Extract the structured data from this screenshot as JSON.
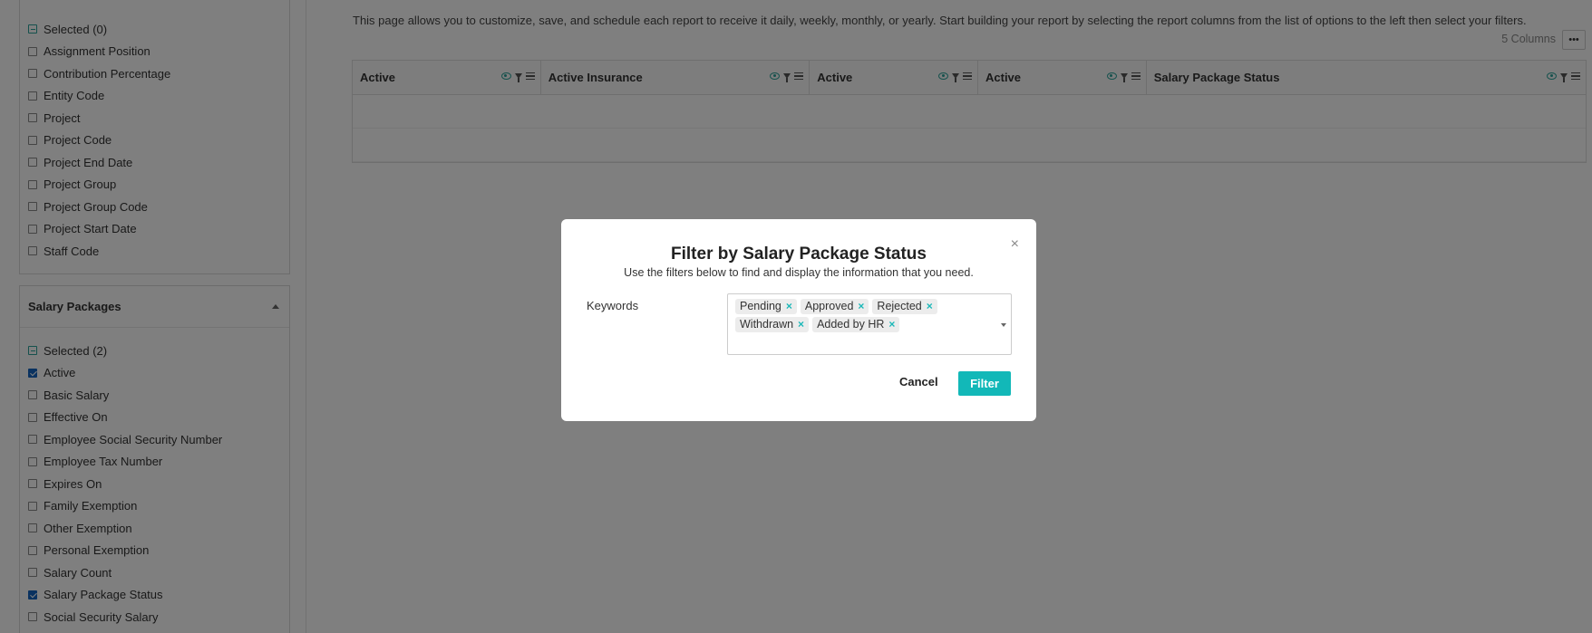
{
  "sidebar": {
    "top_panel": {
      "selected_label": "Selected (0)",
      "items": [
        {
          "label": "Assignment Position",
          "checked": false
        },
        {
          "label": "Contribution Percentage",
          "checked": false
        },
        {
          "label": "Entity Code",
          "checked": false
        },
        {
          "label": "Project",
          "checked": false
        },
        {
          "label": "Project Code",
          "checked": false
        },
        {
          "label": "Project End Date",
          "checked": false
        },
        {
          "label": "Project Group",
          "checked": false
        },
        {
          "label": "Project Group Code",
          "checked": false
        },
        {
          "label": "Project Start Date",
          "checked": false
        },
        {
          "label": "Staff Code",
          "checked": false
        }
      ]
    },
    "salary_panel": {
      "title": "Salary Packages",
      "selected_label": "Selected (2)",
      "items": [
        {
          "label": "Active",
          "checked": true
        },
        {
          "label": "Basic Salary",
          "checked": false
        },
        {
          "label": "Effective On",
          "checked": false
        },
        {
          "label": "Employee Social Security Number",
          "checked": false
        },
        {
          "label": "Employee Tax Number",
          "checked": false
        },
        {
          "label": "Expires On",
          "checked": false
        },
        {
          "label": "Family Exemption",
          "checked": false
        },
        {
          "label": "Other Exemption",
          "checked": false
        },
        {
          "label": "Personal Exemption",
          "checked": false
        },
        {
          "label": "Salary Count",
          "checked": false
        },
        {
          "label": "Salary Package Status",
          "checked": true
        },
        {
          "label": "Social Security Salary",
          "checked": false
        }
      ]
    }
  },
  "main": {
    "description": "This page allows you to customize, save, and schedule each report to receive it daily, weekly, monthly, or yearly. Start building your report by selecting the report columns from the list of options to the left then select your filters.",
    "column_count": "5 Columns",
    "more_label": "•••",
    "columns": [
      "Active",
      "Active Insurance",
      "Active",
      "Active",
      "Salary Package Status"
    ]
  },
  "modal": {
    "title": "Filter by Salary Package Status",
    "subtitle": "Use the filters below to find and display the information that you need.",
    "close_glyph": "×",
    "keywords_label": "Keywords",
    "tags": [
      "Pending",
      "Approved",
      "Rejected",
      "Withdrawn",
      "Added by HR"
    ],
    "remove_glyph": "×",
    "cancel_label": "Cancel",
    "filter_label": "Filter"
  },
  "colors": {
    "accent": "#12b8b8",
    "checkbox_checked": "#1565c0",
    "overlay": "rgba(0,0,0,0.5)"
  }
}
